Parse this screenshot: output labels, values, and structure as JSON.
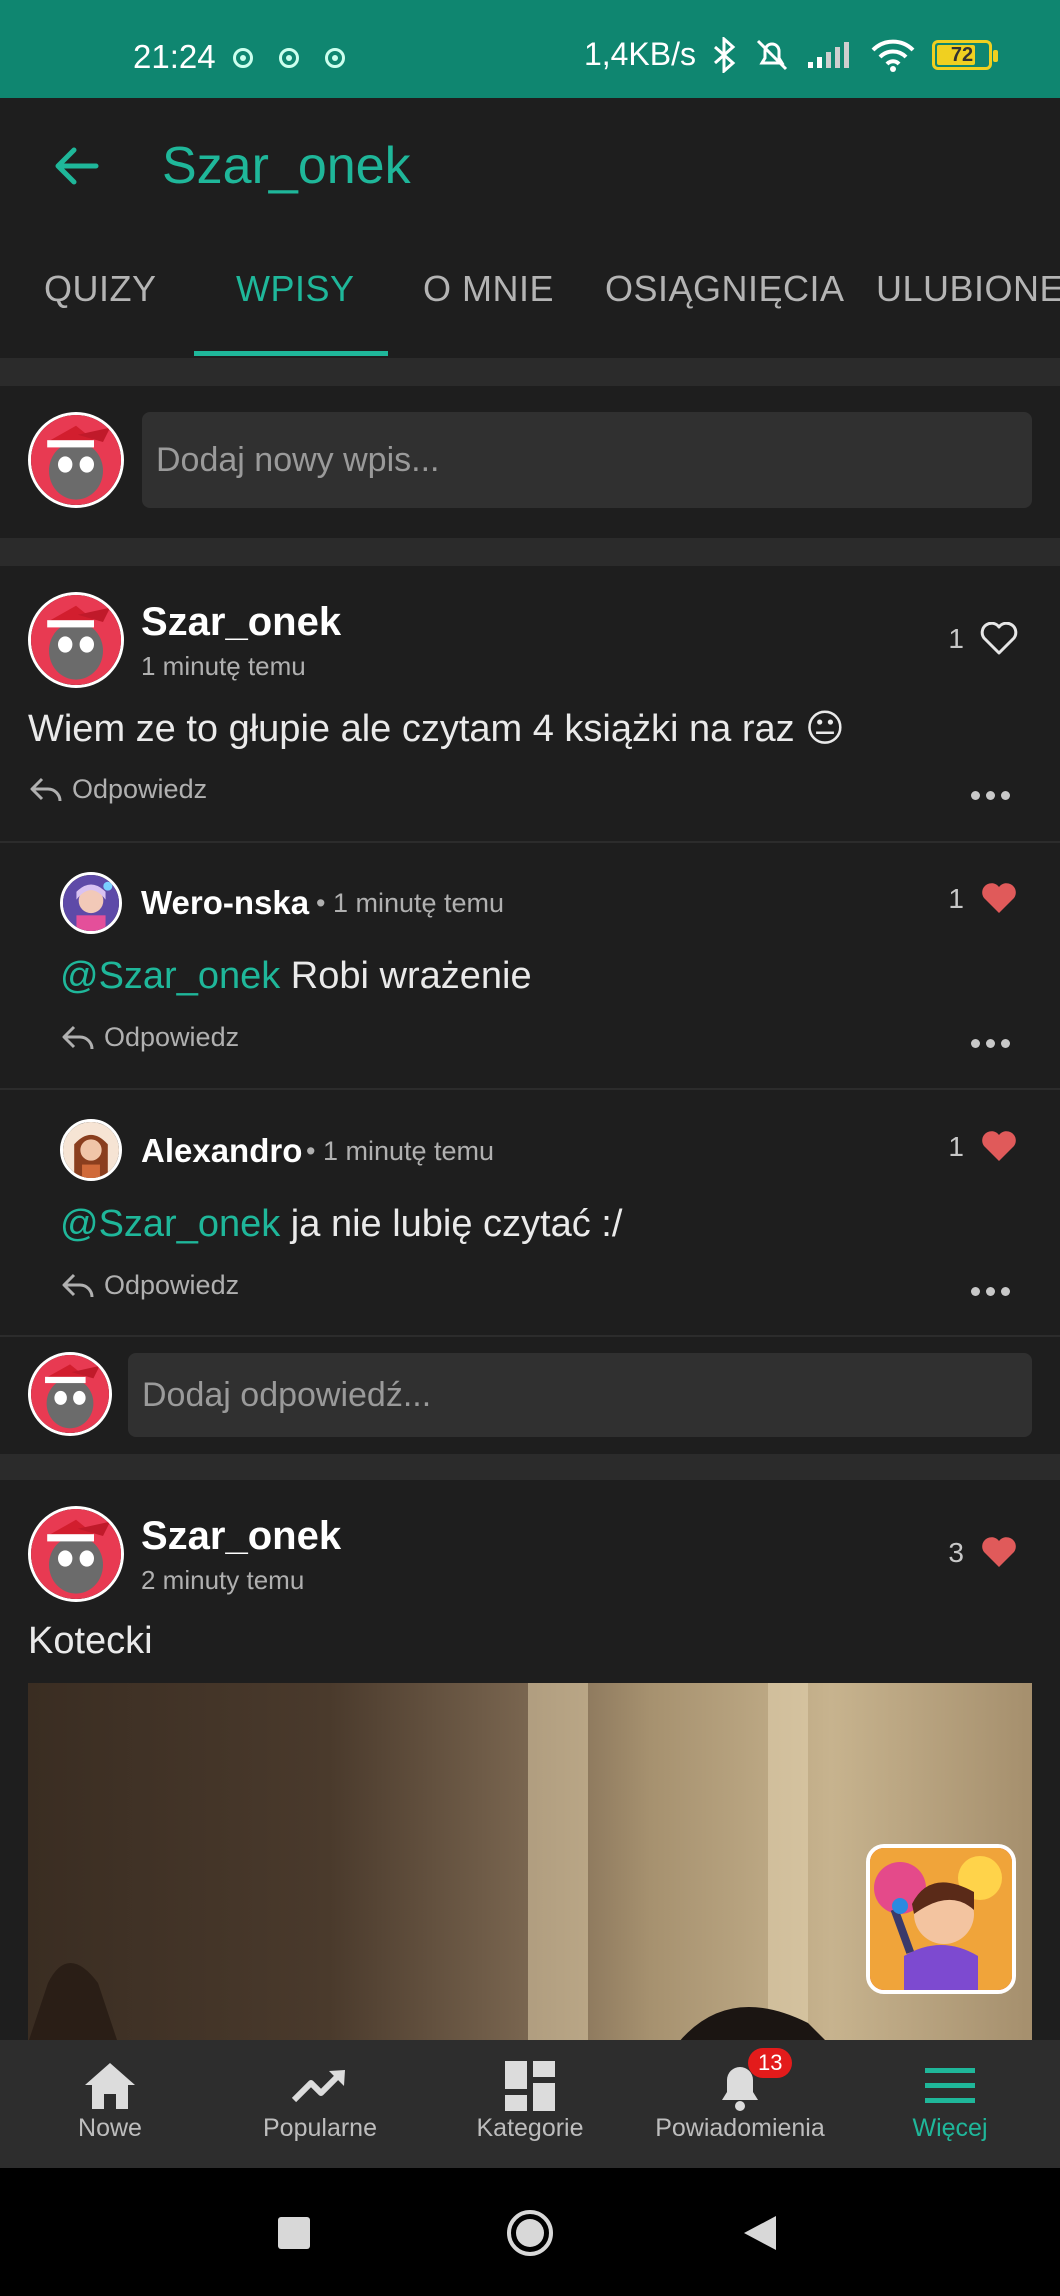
{
  "status_bar": {
    "time": "21:24",
    "speed": "1,4KB/s",
    "battery": "72"
  },
  "header": {
    "title": "Szar_onek"
  },
  "tabs": [
    {
      "label": "QUIZY"
    },
    {
      "label": "WPISY"
    },
    {
      "label": "O MNIE"
    },
    {
      "label": "OSIĄGNIĘCIA"
    },
    {
      "label": "ULUBIONE"
    }
  ],
  "new_post": {
    "placeholder": "Dodaj nowy wpis..."
  },
  "posts": [
    {
      "author": "Szar_onek",
      "time": "1 minutę temu",
      "likes": "1",
      "text": "Wiem ze to głupie ale czytam 4 książki na raz 😐",
      "reply_label": "Odpowiedz",
      "comments": [
        {
          "author": "Wero-nska",
          "time": "• 1 minutę temu",
          "likes": "1",
          "mention": "@Szar_onek",
          "text": " Robi wrażenie",
          "reply_label": "Odpowiedz"
        },
        {
          "author": "Alexandro",
          "time": "• 1 minutę temu",
          "likes": "1",
          "mention": "@Szar_onek",
          "text": " ja nie lubię czytać :/",
          "reply_label": "Odpowiedz"
        }
      ],
      "reply_placeholder": "Dodaj odpowiedź..."
    },
    {
      "author": "Szar_onek",
      "time": "2 minuty temu",
      "likes": "3",
      "text": "Kotecki"
    }
  ],
  "bottom_nav": [
    {
      "label": "Nowe",
      "icon": "home-icon"
    },
    {
      "label": "Popularne",
      "icon": "trending-icon"
    },
    {
      "label": "Kategorie",
      "icon": "grid-icon"
    },
    {
      "label": "Powiadomienia",
      "icon": "bell-icon",
      "badge": "13"
    },
    {
      "label": "Więcej",
      "icon": "menu-icon"
    }
  ],
  "colors": {
    "accent": "#1fb79a",
    "status_bar": "#0f8670",
    "like": "#e05a5a"
  }
}
